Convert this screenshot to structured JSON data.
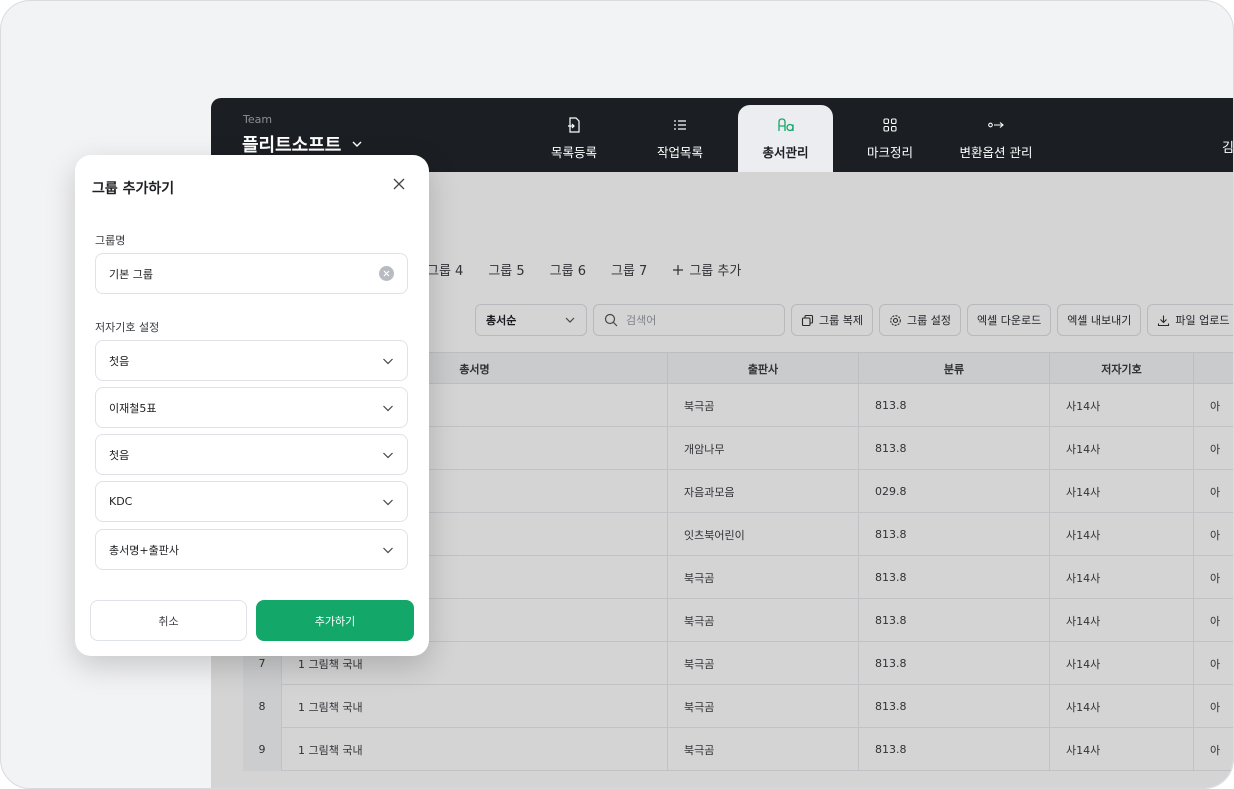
{
  "header": {
    "team_caption": "Team",
    "team_name": "플리트소프트",
    "nav": [
      {
        "label": "목록등록",
        "icon": "file-import-icon"
      },
      {
        "label": "작업목록",
        "icon": "list-icon"
      },
      {
        "label": "총서관리",
        "icon": "text-style-icon",
        "active": true
      },
      {
        "label": "마크정리",
        "icon": "grid-icon"
      },
      {
        "label": "변환옵션 관리",
        "icon": "arrow-transform-icon"
      }
    ],
    "user_initial": "김"
  },
  "tabs": [
    "그룹 4",
    "그룹 5",
    "그룹 6",
    "그룹 7"
  ],
  "add_group_tab": "그룹 추가",
  "toolbar": {
    "sort_value": "총서순",
    "search_placeholder": "검색어",
    "buttons": [
      "그룹 복제",
      "그룹 설정",
      "엑셀 다운로드",
      "엑셀 내보내기",
      "파일 업로드"
    ]
  },
  "table": {
    "columns": [
      "총서명",
      "출판사",
      "분류",
      "저자기호"
    ],
    "rows": [
      {
        "num": "",
        "series": "",
        "publisher": "북극곰",
        "class": "813.8",
        "author_code": "사14사",
        "extra": "아"
      },
      {
        "num": "",
        "series": "",
        "publisher": "개암나무",
        "class": "813.8",
        "author_code": "사14사",
        "extra": "아"
      },
      {
        "num": "",
        "series": "",
        "publisher": "자음과모음",
        "class": "029.8",
        "author_code": "사14사",
        "extra": "아"
      },
      {
        "num": "",
        "series": "",
        "publisher": "잇츠북어린이",
        "class": "813.8",
        "author_code": "사14사",
        "extra": "아"
      },
      {
        "num": "",
        "series": "",
        "publisher": "북극곰",
        "class": "813.8",
        "author_code": "사14사",
        "extra": "아"
      },
      {
        "num": "",
        "series": "",
        "publisher": "북극곰",
        "class": "813.8",
        "author_code": "사14사",
        "extra": "아"
      },
      {
        "num": "7",
        "series": "1 그림책 국내",
        "publisher": "북극곰",
        "class": "813.8",
        "author_code": "사14사",
        "extra": "아"
      },
      {
        "num": "8",
        "series": "1 그림책 국내",
        "publisher": "북극곰",
        "class": "813.8",
        "author_code": "사14사",
        "extra": "아"
      },
      {
        "num": "9",
        "series": "1 그림책 국내",
        "publisher": "북극곰",
        "class": "813.8",
        "author_code": "사14사",
        "extra": "아"
      }
    ]
  },
  "modal": {
    "title": "그룹 추가하기",
    "group_name_label": "그룹명",
    "group_name_value": "기본 그룹",
    "author_code_label": "저자기호 설정",
    "selects": [
      "첫음",
      "이재철5표",
      "첫음",
      "KDC",
      "총서명+출판사"
    ],
    "cancel_label": "취소",
    "submit_label": "추가하기"
  },
  "colors": {
    "accent": "#13a86a",
    "topbar": "#1b1e22"
  }
}
